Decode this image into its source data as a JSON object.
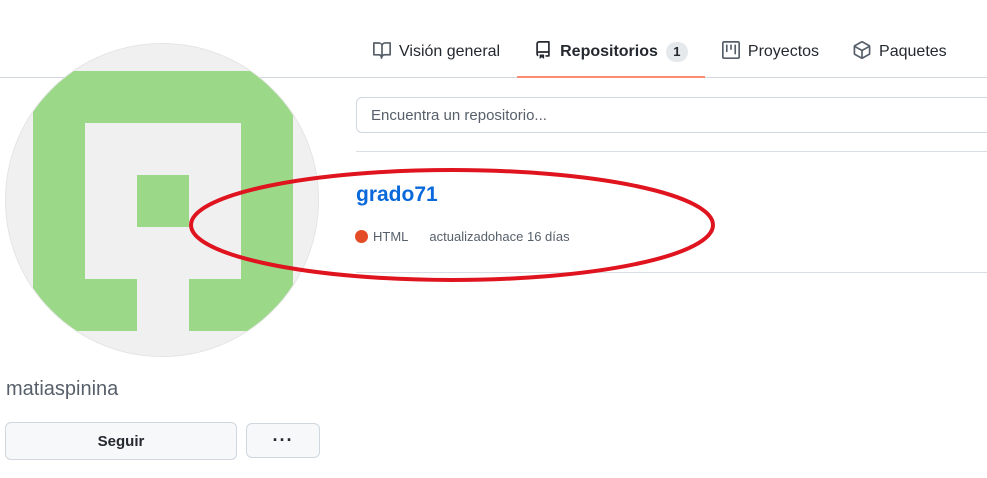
{
  "tabs": [
    {
      "label": "Visión general",
      "icon": "book-icon",
      "selected": false
    },
    {
      "label": "Repositorios",
      "icon": "repo-icon",
      "selected": true,
      "count": "1"
    },
    {
      "label": "Proyectos",
      "icon": "project-icon",
      "selected": false
    },
    {
      "label": "Paquetes",
      "icon": "package-icon",
      "selected": false
    }
  ],
  "profile": {
    "username": "matiaspinina",
    "follow_label": "Seguir",
    "more_label": "···"
  },
  "search": {
    "placeholder": "Encuentra un repositorio..."
  },
  "repositories": [
    {
      "name": "grado71",
      "language": "HTML",
      "language_color": "#e34c26",
      "updated_label": "actualizadohace 16 días"
    }
  ],
  "colors": {
    "accent_tab_underline": "#fd8c73",
    "link": "#0969da",
    "avatar_green": "#9bd888",
    "annotation_red": "#e0141e"
  }
}
